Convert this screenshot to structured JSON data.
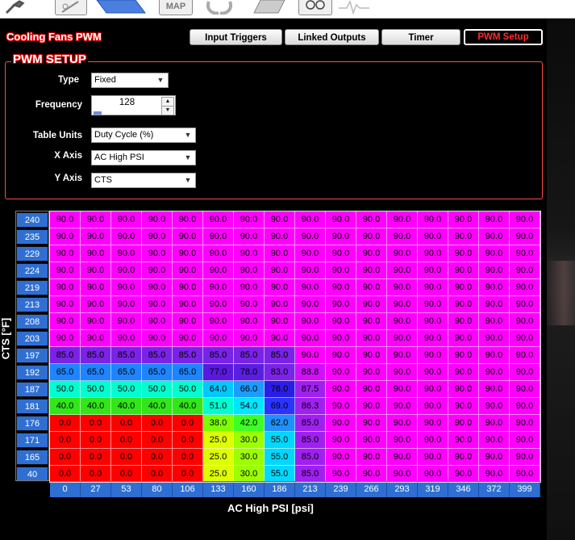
{
  "toolbar": {
    "icons": [
      "wrench-icon",
      "tuning-icon",
      "table-icon",
      "map-icon",
      "refresh-icon",
      "clipboard-icon",
      "gauge-icon",
      "pulse-icon"
    ],
    "map_label": "MAP"
  },
  "page_title": "Cooling Fans PWM",
  "tabs": [
    {
      "label": "Input Triggers",
      "active": false
    },
    {
      "label": "Linked Outputs",
      "active": false
    },
    {
      "label": "Timer",
      "active": false
    },
    {
      "label": "PWM Setup",
      "active": true
    }
  ],
  "pwm_setup": {
    "section_title": "PWM SETUP",
    "type": {
      "label": "Type",
      "value": "Fixed"
    },
    "frequency": {
      "label": "Frequency",
      "value": "128"
    },
    "table_units": {
      "label": "Table Units",
      "value": "Duty Cycle (%)"
    },
    "x_axis": {
      "label": "X Axis",
      "value": "AC High PSI"
    },
    "y_axis": {
      "label": "Y Axis",
      "value": "CTS"
    }
  },
  "table": {
    "x_axis_title": "AC High PSI [psi]",
    "y_axis_title": "CTS [°F]",
    "x_values": [
      "0",
      "27",
      "53",
      "80",
      "106",
      "133",
      "160",
      "186",
      "213",
      "239",
      "266",
      "293",
      "319",
      "346",
      "372",
      "399"
    ],
    "y_values": [
      "240",
      "235",
      "229",
      "224",
      "219",
      "213",
      "208",
      "203",
      "197",
      "192",
      "187",
      "181",
      "176",
      "171",
      "165",
      "40"
    ],
    "rows": [
      [
        "90.0",
        "90.0",
        "90.0",
        "90.0",
        "90.0",
        "90.0",
        "90.0",
        "90.0",
        "90.0",
        "90.0",
        "90.0",
        "90.0",
        "90.0",
        "90.0",
        "90.0",
        "90.0"
      ],
      [
        "90.0",
        "90.0",
        "90.0",
        "90.0",
        "90.0",
        "90.0",
        "90.0",
        "90.0",
        "90.0",
        "90.0",
        "90.0",
        "90.0",
        "90.0",
        "90.0",
        "90.0",
        "90.0"
      ],
      [
        "90.0",
        "90.0",
        "90.0",
        "90.0",
        "90.0",
        "90.0",
        "90.0",
        "90.0",
        "90.0",
        "90.0",
        "90.0",
        "90.0",
        "90.0",
        "90.0",
        "90.0",
        "90.0"
      ],
      [
        "90.0",
        "90.0",
        "90.0",
        "90.0",
        "90.0",
        "90.0",
        "90.0",
        "90.0",
        "90.0",
        "90.0",
        "90.0",
        "90.0",
        "90.0",
        "90.0",
        "90.0",
        "90.0"
      ],
      [
        "90.0",
        "90.0",
        "90.0",
        "90.0",
        "90.0",
        "90.0",
        "90.0",
        "90.0",
        "90.0",
        "90.0",
        "90.0",
        "90.0",
        "90.0",
        "90.0",
        "90.0",
        "90.0"
      ],
      [
        "90.0",
        "90.0",
        "90.0",
        "90.0",
        "90.0",
        "90.0",
        "90.0",
        "90.0",
        "90.0",
        "90.0",
        "90.0",
        "90.0",
        "90.0",
        "90.0",
        "90.0",
        "90.0"
      ],
      [
        "90.0",
        "90.0",
        "90.0",
        "90.0",
        "90.0",
        "90.0",
        "90.0",
        "90.0",
        "90.0",
        "90.0",
        "90.0",
        "90.0",
        "90.0",
        "90.0",
        "90.0",
        "90.0"
      ],
      [
        "90.0",
        "90.0",
        "90.0",
        "90.0",
        "90.0",
        "90.0",
        "90.0",
        "90.0",
        "90.0",
        "90.0",
        "90.0",
        "90.0",
        "90.0",
        "90.0",
        "90.0",
        "90.0"
      ],
      [
        "85.0",
        "85.0",
        "85.0",
        "85.0",
        "85.0",
        "85.0",
        "85.0",
        "85.0",
        "90.0",
        "90.0",
        "90.0",
        "90.0",
        "90.0",
        "90.0",
        "90.0",
        "90.0"
      ],
      [
        "65.0",
        "65.0",
        "65.0",
        "65.0",
        "65.0",
        "77.0",
        "78.0",
        "83.0",
        "88.8",
        "90.0",
        "90.0",
        "90.0",
        "90.0",
        "90.0",
        "90.0",
        "90.0"
      ],
      [
        "50.0",
        "50.0",
        "50.0",
        "50.0",
        "50.0",
        "64.0",
        "66.0",
        "76.0",
        "87.5",
        "90.0",
        "90.0",
        "90.0",
        "90.0",
        "90.0",
        "90.0",
        "90.0"
      ],
      [
        "40.0",
        "40.0",
        "40.0",
        "40.0",
        "40.0",
        "51.0",
        "54.0",
        "69.0",
        "86.3",
        "90.0",
        "90.0",
        "90.0",
        "90.0",
        "90.0",
        "90.0",
        "90.0"
      ],
      [
        "0.0",
        "0.0",
        "0.0",
        "0.0",
        "0.0",
        "38.0",
        "42.0",
        "62.0",
        "85.0",
        "90.0",
        "90.0",
        "90.0",
        "90.0",
        "90.0",
        "90.0",
        "90.0"
      ],
      [
        "0.0",
        "0.0",
        "0.0",
        "0.0",
        "0.0",
        "25.0",
        "30.0",
        "55.0",
        "85.0",
        "90.0",
        "90.0",
        "90.0",
        "90.0",
        "90.0",
        "90.0",
        "90.0"
      ],
      [
        "0.0",
        "0.0",
        "0.0",
        "0.0",
        "0.0",
        "25.0",
        "30.0",
        "55.0",
        "85.0",
        "90.0",
        "90.0",
        "90.0",
        "90.0",
        "90.0",
        "90.0",
        "90.0"
      ],
      [
        "0.0",
        "0.0",
        "0.0",
        "0.0",
        "0.0",
        "25.0",
        "30.0",
        "55.0",
        "85.0",
        "90.0",
        "90.0",
        "90.0",
        "90.0",
        "90.0",
        "90.0",
        "90.0"
      ]
    ]
  },
  "colors": {
    "title_glow": "#cc0000",
    "axis_cell": "#2f6fd3",
    "active_tab_text": "#ff2a2a"
  }
}
